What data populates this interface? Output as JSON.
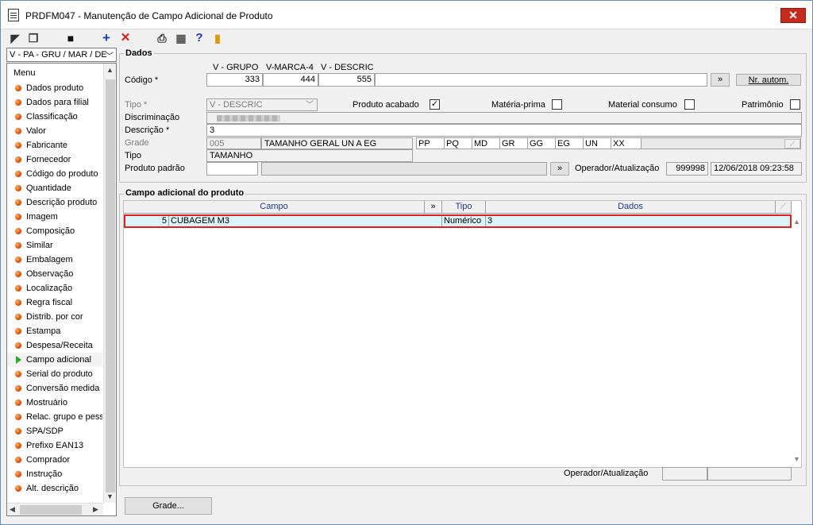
{
  "window": {
    "title": "PRDFM047 - Manutenção de Campo Adicional de Produto",
    "close_label": "✕"
  },
  "toolbar": {
    "icons": [
      "back-icon",
      "copy-icon",
      "save-icon",
      "add-icon",
      "delete-icon",
      "print-icon",
      "calculator-icon",
      "help-icon",
      "exit-icon"
    ]
  },
  "sidebar": {
    "selector_value": "V - PA - GRU / MAR / DE",
    "menu_title": "Menu",
    "items": [
      {
        "label": "Dados produto"
      },
      {
        "label": "Dados para filial"
      },
      {
        "label": "Classificação"
      },
      {
        "label": "Valor"
      },
      {
        "label": "Fabricante"
      },
      {
        "label": "Fornecedor"
      },
      {
        "label": "Código do produto"
      },
      {
        "label": "Quantidade"
      },
      {
        "label": "Descrição produto"
      },
      {
        "label": "Imagem"
      },
      {
        "label": "Composição"
      },
      {
        "label": "Similar"
      },
      {
        "label": "Embalagem"
      },
      {
        "label": "Observação"
      },
      {
        "label": "Localização"
      },
      {
        "label": "Regra fiscal"
      },
      {
        "label": "Distrib. por cor"
      },
      {
        "label": "Estampa"
      },
      {
        "label": "Despesa/Receita"
      },
      {
        "label": "Campo adicional",
        "active": true
      },
      {
        "label": "Serial do produto"
      },
      {
        "label": "Conversão medida"
      },
      {
        "label": "Mostruário"
      },
      {
        "label": "Relac. grupo e pess"
      },
      {
        "label": "SPA/SDP"
      },
      {
        "label": "Prefixo EAN13"
      },
      {
        "label": "Comprador"
      },
      {
        "label": "Instrução"
      },
      {
        "label": "Alt. descrição"
      }
    ]
  },
  "dados": {
    "title": "Dados",
    "code_headers": [
      "V - GRUPO",
      "V-MARCA-4",
      "V - DESCRIC"
    ],
    "codigo_label": "Código *",
    "codigo_values": [
      "333",
      "444",
      "555"
    ],
    "expand_label": "»",
    "nr_autom_label": "Nr. autom.",
    "tipo_label": "Tipo *",
    "tipo_value": "V - DESCRIC",
    "produto_acabado_label": "Produto acabado",
    "produto_acabado_checked": "✓",
    "materia_prima_label": "Matéria-prima",
    "material_consumo_label": "Material consumo",
    "patrimonio_label": "Patrimônio",
    "discriminacao_label": "Discriminação",
    "descricao_label": "Descrição *",
    "descricao_value": "3",
    "grade_label": "Grade",
    "grade_code": "005",
    "grade_name": "TAMANHO GERAL UN A EG",
    "grade_sizes": [
      "PP",
      "PQ",
      "MD",
      "GR",
      "GG",
      "EG",
      "UN",
      "XX"
    ],
    "tipo2_label": "Tipo",
    "tipo2_value": "TAMANHO",
    "produto_padrao_label": "Produto padrão",
    "operador_label": "Operador/Atualização",
    "operador_value": "999998",
    "operador_date": "12/06/2018 09:23:58"
  },
  "campo_adicional": {
    "title": "Campo adicional do produto",
    "columns": [
      "Campo",
      "»",
      "Tipo",
      "Dados"
    ],
    "rows": [
      {
        "id": "5",
        "campo": "CUBAGEM M3",
        "tipo": "Numérico",
        "dados": "3"
      }
    ],
    "operador_label": "Operador/Atualização"
  },
  "footer": {
    "grade_button": "Grade..."
  }
}
